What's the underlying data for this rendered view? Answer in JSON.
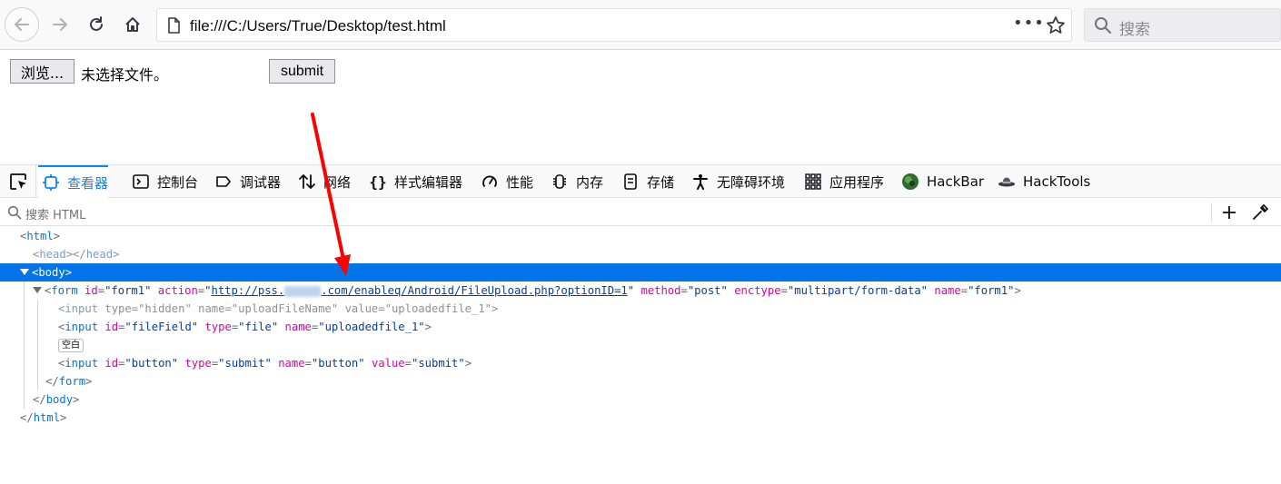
{
  "browser": {
    "url": "file:///C:/Users/True/Desktop/test.html",
    "search_placeholder": "搜索",
    "page_actions": "•••"
  },
  "page": {
    "browse_label": "浏览...",
    "file_status": "未选择文件。",
    "submit_label": "submit"
  },
  "devtools": {
    "tabs": [
      {
        "label": "查看器",
        "icon": "inspector-icon",
        "selected": true
      },
      {
        "label": "控制台",
        "icon": "console-icon"
      },
      {
        "label": "调试器",
        "icon": "debugger-icon"
      },
      {
        "label": "网络",
        "icon": "network-icon"
      },
      {
        "label": "样式编辑器",
        "icon": "style-editor-icon"
      },
      {
        "label": "性能",
        "icon": "performance-icon"
      },
      {
        "label": "内存",
        "icon": "memory-icon"
      },
      {
        "label": "存储",
        "icon": "storage-icon"
      },
      {
        "label": "无障碍环境",
        "icon": "accessibility-icon"
      },
      {
        "label": "应用程序",
        "icon": "application-icon"
      },
      {
        "label": "HackBar",
        "icon": "hackbar-icon"
      },
      {
        "label": "HackTools",
        "icon": "hacktools-icon"
      }
    ],
    "search_placeholder": "搜索 HTML",
    "markup": {
      "html_open": "html",
      "head": "head",
      "body_open": "body",
      "form_tag": "form",
      "form_id_attr": "id",
      "form_id_val": "\"form1\"",
      "form_action_attr": "action",
      "form_action_pre": "http://pss.",
      "form_action_post": ".com/enableq/Android/FileUpload.php?optionID=1",
      "form_method_attr": "method",
      "form_method_val": "\"post\"",
      "form_enctype_attr": "enctype",
      "form_enctype_val": "\"multipart/form-data\"",
      "form_name_attr": "name",
      "form_name_val": "\"form1\"",
      "input_tag": "input",
      "type_attr": "type",
      "name_attr": "name",
      "value_attr": "value",
      "id_attr": "id",
      "hidden_type": "\"hidden\"",
      "hidden_name": "\"uploadFileName\"",
      "hidden_value": "\"uploadedfile_1\"",
      "file_id": "\"fileField\"",
      "file_type": "\"file\"",
      "file_name": "\"uploadedfile_1\"",
      "whitespace_badge": "空白",
      "btn_id": "\"button\"",
      "btn_type": "\"submit\"",
      "btn_name": "\"button\"",
      "btn_value": "\"submit\""
    }
  },
  "colors": {
    "selected_row": "#0074e8",
    "tab_accent": "#0a84ff",
    "attr_name": "#dd00a9",
    "attr_value": "#003eaa",
    "arrow": "#ff0000"
  }
}
